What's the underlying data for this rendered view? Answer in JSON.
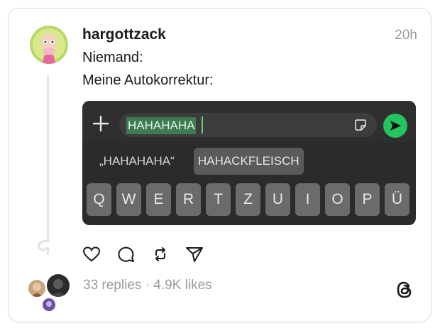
{
  "post": {
    "username": "hargottzack",
    "timestamp": "20h",
    "text_line1": "Niemand:",
    "text_line2": "Meine Autokorrektur:"
  },
  "media": {
    "input_text": "HAHAHAHA",
    "suggestion_1": "„HAHAHAHA“",
    "suggestion_2": "HAHACKFLEISCH",
    "keys": [
      "Q",
      "W",
      "E",
      "R",
      "T",
      "Z",
      "U",
      "I",
      "O",
      "P",
      "Ü"
    ]
  },
  "stats": {
    "text": "33 replies · 4.9K likes"
  },
  "icons": {
    "like": "heart-icon",
    "reply": "comment-icon",
    "repost": "repost-icon",
    "share": "send-icon",
    "logo": "threads-logo-icon"
  },
  "colors": {
    "send_button": "#22c55e",
    "selected_text_bg": "#3e7a52"
  }
}
